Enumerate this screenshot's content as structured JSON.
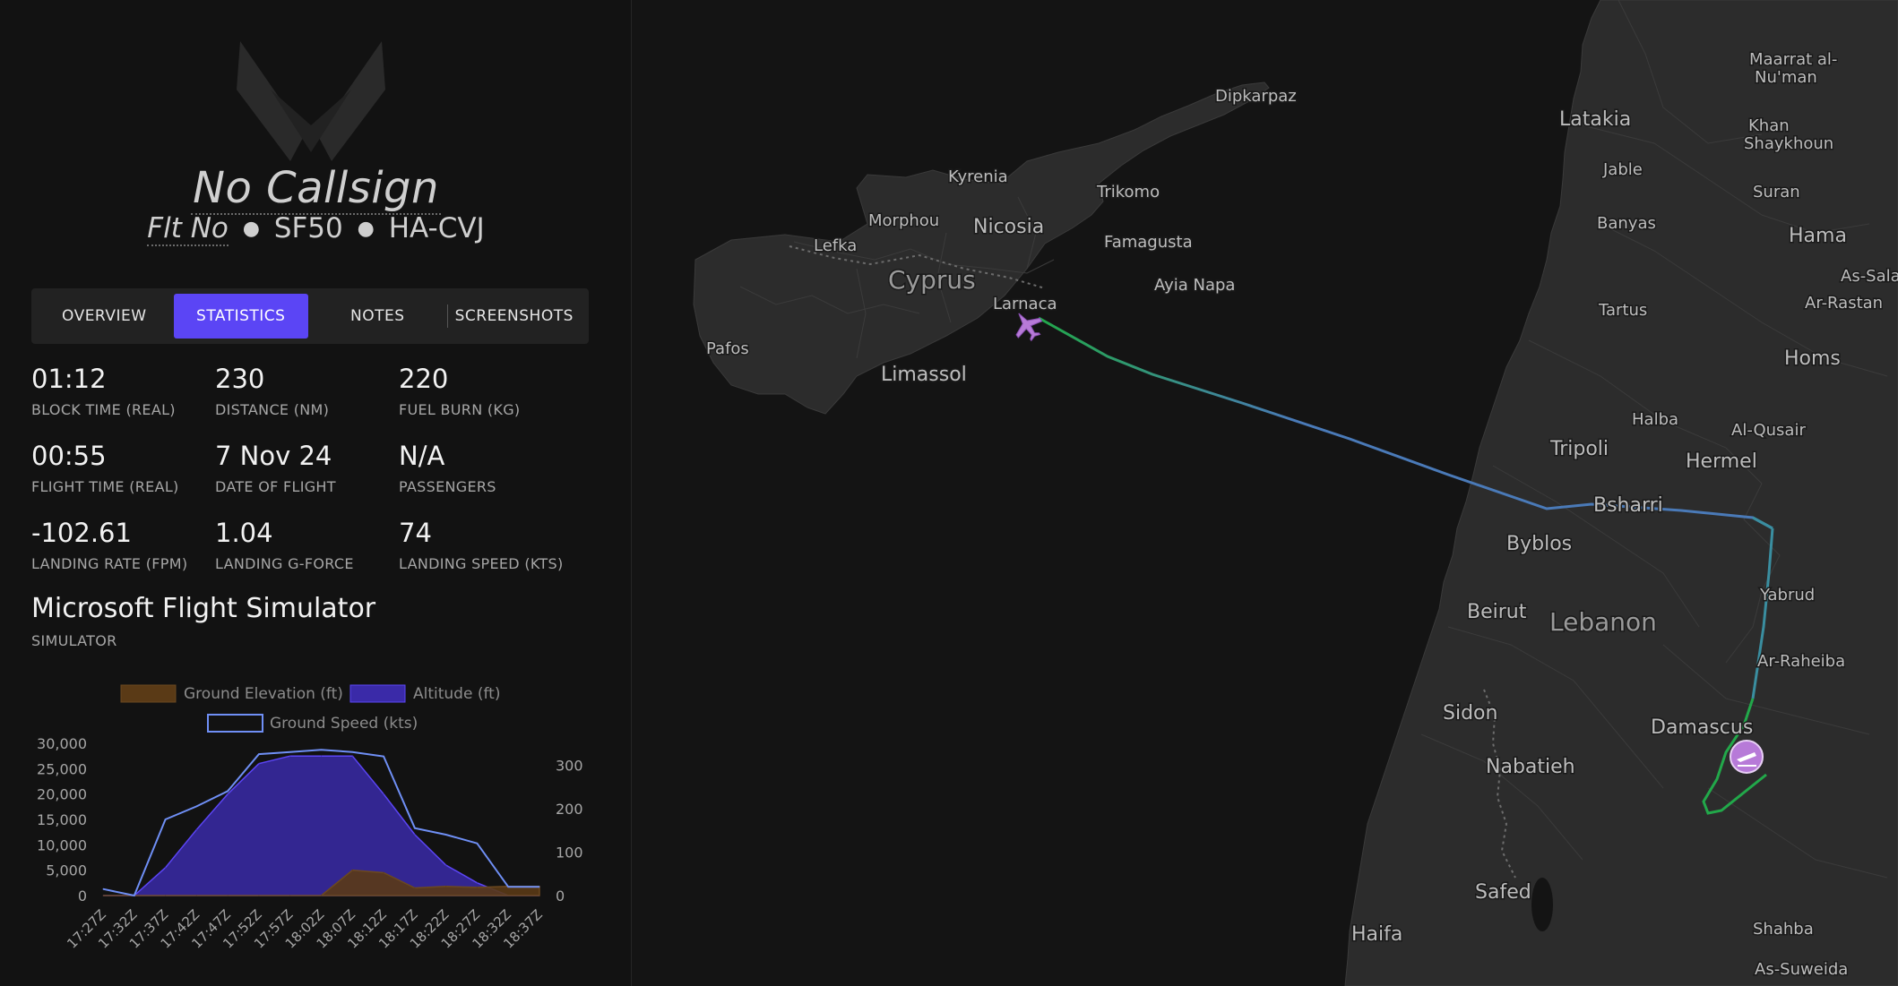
{
  "flight": {
    "callsign": "No Callsign",
    "flight_number": "Flt No",
    "aircraft_type": "SF50",
    "registration": "HA-CVJ",
    "separator": "●"
  },
  "tabs": [
    {
      "label": "OVERVIEW",
      "active": false
    },
    {
      "label": "STATISTICS",
      "active": true
    },
    {
      "label": "NOTES",
      "active": false
    },
    {
      "label": "SCREENSHOTS",
      "active": false
    }
  ],
  "stats": [
    {
      "value": "01:12",
      "label": "BLOCK TIME (REAL)"
    },
    {
      "value": "230",
      "label": "DISTANCE (NM)"
    },
    {
      "value": "220",
      "label": "FUEL BURN (KG)"
    },
    {
      "value": "00:55",
      "label": "FLIGHT TIME (REAL)"
    },
    {
      "value": "7 Nov 24",
      "label": "DATE OF FLIGHT"
    },
    {
      "value": "N/A",
      "label": "PASSENGERS"
    },
    {
      "value": "-102.61",
      "label": "LANDING RATE (FPM)"
    },
    {
      "value": "1.04",
      "label": "LANDING G-FORCE"
    },
    {
      "value": "74",
      "label": "LANDING SPEED (KTS)"
    }
  ],
  "simulator": {
    "name": "Microsoft Flight Simulator",
    "label": "SIMULATOR"
  },
  "colors": {
    "accent": "#5b45f5",
    "ground_elevation": "#5a3a16",
    "altitude": "#3a2aa8",
    "ground_speed": "#6f8ff5",
    "route_green": "#22a84a",
    "route_blue": "#4a7ab8",
    "marker": "#b77ad8"
  },
  "chart_data": {
    "type": "area",
    "x": [
      "17:27Z",
      "17:32Z",
      "17:37Z",
      "17:42Z",
      "17:47Z",
      "17:52Z",
      "17:57Z",
      "18:02Z",
      "18:07Z",
      "18:12Z",
      "18:17Z",
      "18:22Z",
      "18:27Z",
      "18:32Z",
      "18:37Z"
    ],
    "y_left_ticks": [
      "0",
      "5,000",
      "10,000",
      "15,000",
      "20,000",
      "25,000",
      "30,000"
    ],
    "y_left_lim": [
      0,
      30000
    ],
    "y_right_ticks": [
      "0",
      "100",
      "200",
      "300"
    ],
    "y_right_lim": [
      0,
      350
    ],
    "series": [
      {
        "name": "Ground Elevation (ft)",
        "axis": "left",
        "style": "area",
        "values": [
          0,
          0,
          0,
          0,
          0,
          0,
          0,
          0,
          5000,
          4500,
          1500,
          1800,
          1600,
          1800,
          1800
        ]
      },
      {
        "name": "Altitude (ft)",
        "axis": "left",
        "style": "area",
        "values": [
          0,
          0,
          5500,
          13000,
          20000,
          26000,
          27500,
          27500,
          27500,
          20000,
          12000,
          6000,
          2500,
          0,
          0
        ]
      },
      {
        "name": "Ground Speed (kts)",
        "axis": "right",
        "style": "line",
        "values": [
          15,
          0,
          175,
          205,
          240,
          325,
          330,
          335,
          330,
          320,
          155,
          140,
          120,
          20,
          20
        ]
      }
    ]
  },
  "map": {
    "labels": [
      {
        "text": "Dipkarpaz",
        "size": "s"
      },
      {
        "text": "Kyrenia",
        "size": "s"
      },
      {
        "text": "Trikomo",
        "size": "s"
      },
      {
        "text": "Morphou",
        "size": "s"
      },
      {
        "text": "Nicosia",
        "size": "m"
      },
      {
        "text": "Famagusta",
        "size": "s"
      },
      {
        "text": "Lefka",
        "size": "s"
      },
      {
        "text": "Cyprus",
        "size": "l"
      },
      {
        "text": "Ayia Napa",
        "size": "s"
      },
      {
        "text": "Larnaca",
        "size": "s"
      },
      {
        "text": "Pafos",
        "size": "s"
      },
      {
        "text": "Limassol",
        "size": "m"
      },
      {
        "text": "Latakia",
        "size": "m"
      },
      {
        "text": "Jable",
        "size": "s"
      },
      {
        "text": "Banyas",
        "size": "s"
      },
      {
        "text": "Tartus",
        "size": "s"
      },
      {
        "text": "Maarrat al-",
        "size": "s"
      },
      {
        "text": "Nu'man",
        "size": "s"
      },
      {
        "text": "Khan",
        "size": "s"
      },
      {
        "text": "Shaykhoun",
        "size": "s"
      },
      {
        "text": "Suran",
        "size": "s"
      },
      {
        "text": "Hama",
        "size": "m"
      },
      {
        "text": "As-Sala",
        "size": "s"
      },
      {
        "text": "Ar-Rastan",
        "size": "s"
      },
      {
        "text": "Homs",
        "size": "m"
      },
      {
        "text": "Halba",
        "size": "s"
      },
      {
        "text": "Al-Qusair",
        "size": "s"
      },
      {
        "text": "Tripoli",
        "size": "m"
      },
      {
        "text": "Hermel",
        "size": "m"
      },
      {
        "text": "Bsharri",
        "size": "m"
      },
      {
        "text": "Byblos",
        "size": "m"
      },
      {
        "text": "Yabrud",
        "size": "s"
      },
      {
        "text": "Beirut",
        "size": "m"
      },
      {
        "text": "Lebanon",
        "size": "l"
      },
      {
        "text": "Ar-Raheiba",
        "size": "s"
      },
      {
        "text": "Sidon",
        "size": "m"
      },
      {
        "text": "Damascus",
        "size": "m"
      },
      {
        "text": "Nabatieh",
        "size": "m"
      },
      {
        "text": "Safed",
        "size": "m"
      },
      {
        "text": "Haifa",
        "size": "m"
      },
      {
        "text": "Shahba",
        "size": "s"
      },
      {
        "text": "As-Suweida",
        "size": "s"
      }
    ]
  }
}
